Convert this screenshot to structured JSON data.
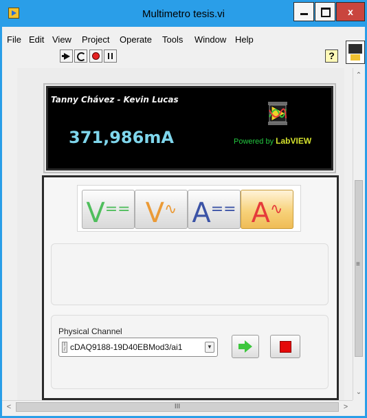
{
  "window": {
    "title": "Multimetro tesis.vi",
    "close_label": "x"
  },
  "menu": [
    "File",
    "Edit",
    "View",
    "Project",
    "Operate",
    "Tools",
    "Window",
    "Help"
  ],
  "toolbar": {
    "help_label": "?"
  },
  "display": {
    "authors": "Tanny Chávez - Kevin Lucas",
    "reading": "371,986mA",
    "powered_by": "Powered by",
    "brand": "LabVIEW"
  },
  "modes": [
    {
      "letter": "V",
      "symbol": "==",
      "active": false
    },
    {
      "letter": "V",
      "symbol": "∿",
      "active": false
    },
    {
      "letter": "A",
      "symbol": "==",
      "active": false
    },
    {
      "letter": "A",
      "symbol": "∿",
      "active": true
    }
  ],
  "channel": {
    "label": "Physical Channel",
    "value": "cDAQ9188-19D40EBMod3/ai1"
  },
  "scroll": {
    "up_glyph": "⌃",
    "down_glyph": "⌄",
    "left_glyph": "<",
    "right_glyph": ">",
    "thumb_glyph": "III"
  },
  "colors": {
    "titlebar": "#2a9ee8",
    "reading": "#7fd6ec",
    "powered": "#22c63f",
    "active_mode": "#f7d27a",
    "stop": "#e40a0a"
  }
}
